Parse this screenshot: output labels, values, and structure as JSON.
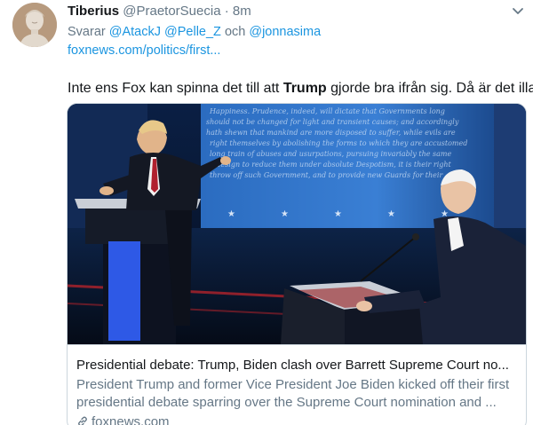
{
  "tweet": {
    "display_name": "Tiberius",
    "handle": "@PraetorSuecia",
    "separator": "·",
    "time": "8m",
    "reply_prefix": "Svarar",
    "mention_1": "@AtackJ",
    "mention_2": "@Pelle_Z",
    "conjunction": "och",
    "mention_3": "@jonnasima",
    "link": "foxnews.com/politics/first...",
    "text_before": "Inte ens Fox kan spinna det till att ",
    "text_bold": "Trump",
    "text_after": " gjorde bra ifrån sig. Då är det illa."
  },
  "card": {
    "title": "Presidential debate: Trump, Biden clash over Barrett Supreme Court no...",
    "description_line1": "President Trump and former Vice President Joe Biden kicked off their first",
    "description_line2": "presidential debate sparring over the Supreme Court nomination and ...",
    "domain": "foxnews.com",
    "image_text": "Happiness. Prudence, indeed, will dictate that Governments long established should not be changed for light and transient causes; and accordingly all experience hath shewn that mankind are more disposed to suffer, while evils are sufferable than to right themselves by abolishing the forms to which they are accustomed. But when a long train of abuses and usurpations, pursuing invariably the same Object evinces a design to reduce them under absolute Despotism, it is their right, it is their duty, to throw off such Government, and to provide new Guards for their future security."
  },
  "icons": {
    "avatar": "bust-statue-avatar",
    "caret": "chevron-down-icon",
    "link": "link-icon"
  },
  "colors": {
    "link_blue": "#1b95e0",
    "secondary_gray": "#657786",
    "stage_blue": "#2a6fc4",
    "podium_blue": "#1e4fd8"
  }
}
